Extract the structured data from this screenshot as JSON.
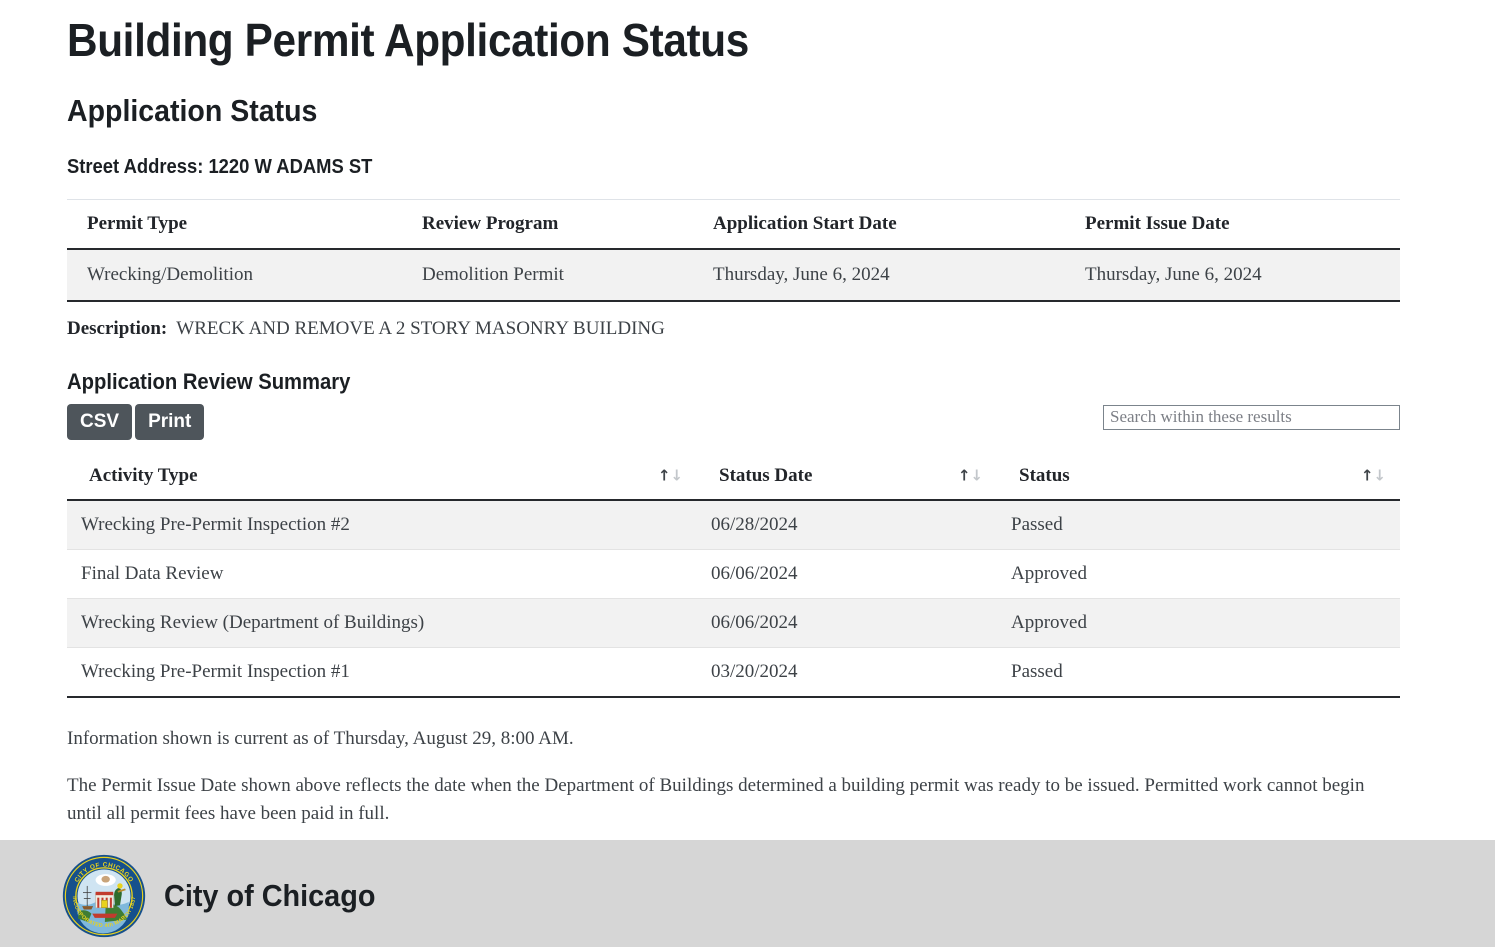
{
  "page": {
    "title": "Building Permit Application Status",
    "section_heading": "Application Status",
    "street_address_line": "Street Address: 1220 W ADAMS ST"
  },
  "permit_table": {
    "headers": [
      "Permit Type",
      "Review Program",
      "Application Start Date",
      "Permit Issue Date"
    ],
    "row": {
      "permit_type": "Wrecking/Demolition",
      "review_program": "Demolition Permit",
      "application_start_date": "Thursday, June 6, 2024",
      "permit_issue_date": "Thursday, June 6, 2024"
    }
  },
  "description": {
    "label": "Description:",
    "value": "WRECK AND REMOVE A 2 STORY MASONRY BUILDING"
  },
  "review_summary": {
    "heading": "Application Review Summary",
    "buttons": {
      "csv": "CSV",
      "print": "Print"
    },
    "search": {
      "placeholder": "Search within these results",
      "value": ""
    },
    "headers": {
      "activity_type": "Activity Type",
      "status_date": "Status Date",
      "status": "Status"
    },
    "sort_icon": {
      "ascending": "↑",
      "descending": "↓"
    },
    "rows": [
      {
        "activity_type": "Wrecking Pre-Permit Inspection #2",
        "status_date": "06/28/2024",
        "status": "Passed"
      },
      {
        "activity_type": "Final Data Review",
        "status_date": "06/06/2024",
        "status": "Approved"
      },
      {
        "activity_type": "Wrecking Review (Department of Buildings)",
        "status_date": "06/06/2024",
        "status": "Approved"
      },
      {
        "activity_type": "Wrecking Pre-Permit Inspection #1",
        "status_date": "03/20/2024",
        "status": "Passed"
      }
    ]
  },
  "notes": {
    "currency": "Information shown is current as of Thursday, August 29, 8:00 AM.",
    "disclaimer": "The Permit Issue Date shown above reflects the date when the Department of Buildings determined a building permit was ready to be issued. Permitted work cannot begin until all permit fees have been paid in full."
  },
  "footer": {
    "organization": "City of Chicago",
    "seal_text_top": "CITY OF CHICAGO",
    "seal_text_bottom": "INCORPORATED 4th MARCH 1837"
  },
  "colors": {
    "button_bg": "#4e555b",
    "row_alt_bg": "#f2f2f2",
    "footer_bg": "#d6d6d6",
    "rule": "#26292d",
    "text": "#3d4247",
    "seal_ring": "#1b4f8a",
    "seal_ring_accent": "#e8d21e"
  }
}
